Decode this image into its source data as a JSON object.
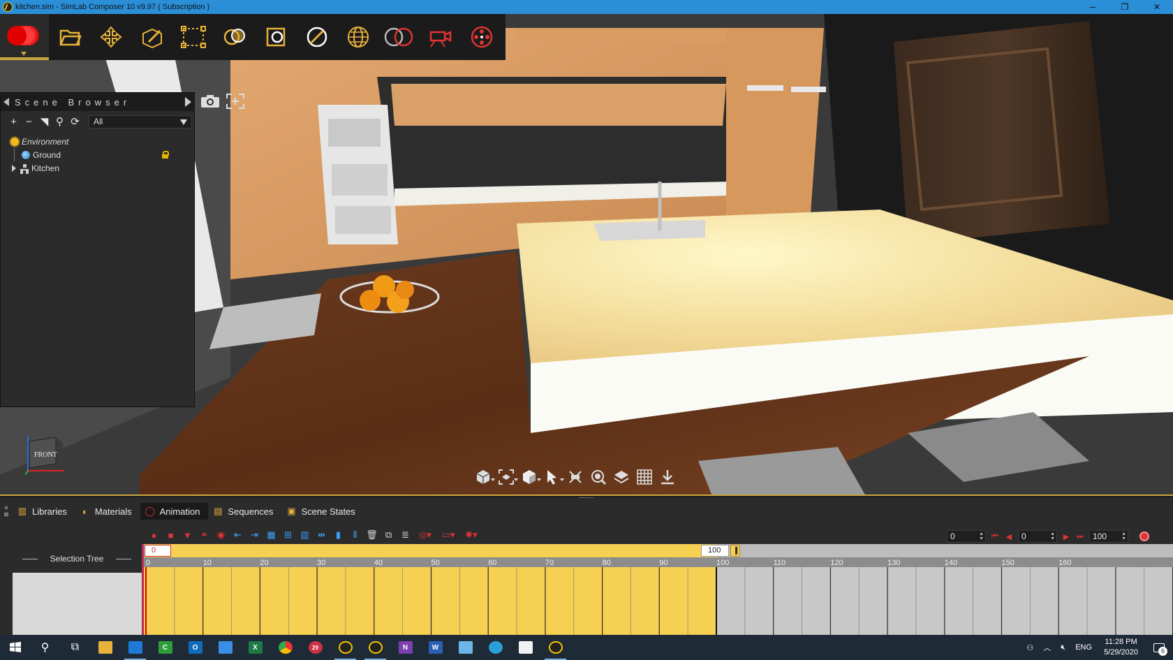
{
  "window": {
    "title": "kitchen.sim - SimLab Composer 10 v9.97 ( Subscription )",
    "minimize": "─",
    "maximize": "❐",
    "close": "✕"
  },
  "main_toolbar": {
    "icons": [
      "record-icon",
      "open-file-icon",
      "move-icon",
      "edit-icon",
      "selection-icon",
      "materials-icon",
      "frame-icon",
      "no-entry-icon",
      "environment-globe-icon",
      "render-icon",
      "camera-rig-icon",
      "film-reel-icon"
    ]
  },
  "scene_browser": {
    "title": "Scene Browser",
    "filter_value": "All",
    "tree": [
      {
        "label": "Environment",
        "icon": "sun-icon"
      },
      {
        "label": "Ground",
        "icon": "globe-icon",
        "locked": true
      },
      {
        "label": "Kitchen",
        "icon": "group-icon",
        "expandable": true
      }
    ]
  },
  "navcube": {
    "face_label": "FRONT"
  },
  "tabs": [
    {
      "label": "Libraries",
      "icon": "libraries-icon"
    },
    {
      "label": "Materials",
      "icon": "materials-icon"
    },
    {
      "label": "Animation",
      "icon": "animation-icon",
      "active": true
    },
    {
      "label": "Sequences",
      "icon": "sequences-icon"
    },
    {
      "label": "Scene States",
      "icon": "scene-states-icon"
    }
  ],
  "animation": {
    "selection_tree_label": "Selection Tree",
    "current_time": "0",
    "current_frame": "0",
    "end_frame": "100",
    "range_start": "0",
    "range_end": "100",
    "range_flag": "▐",
    "ruler_ticks": [
      "0",
      "10",
      "20",
      "30",
      "40",
      "50",
      "60",
      "70",
      "80",
      "90",
      "100",
      "110",
      "120",
      "130",
      "140",
      "150",
      "160"
    ]
  },
  "taskbar": {
    "tray_lang": "ENG",
    "time": "11:28 PM",
    "date": "5/29/2020",
    "notifications": "6",
    "chrome_badge": "29"
  },
  "colors": {
    "titlebar": "#2b8fd8",
    "accent_gold": "#c9a640",
    "timeline_range": "#f6d052",
    "record_red": "#e03333"
  }
}
